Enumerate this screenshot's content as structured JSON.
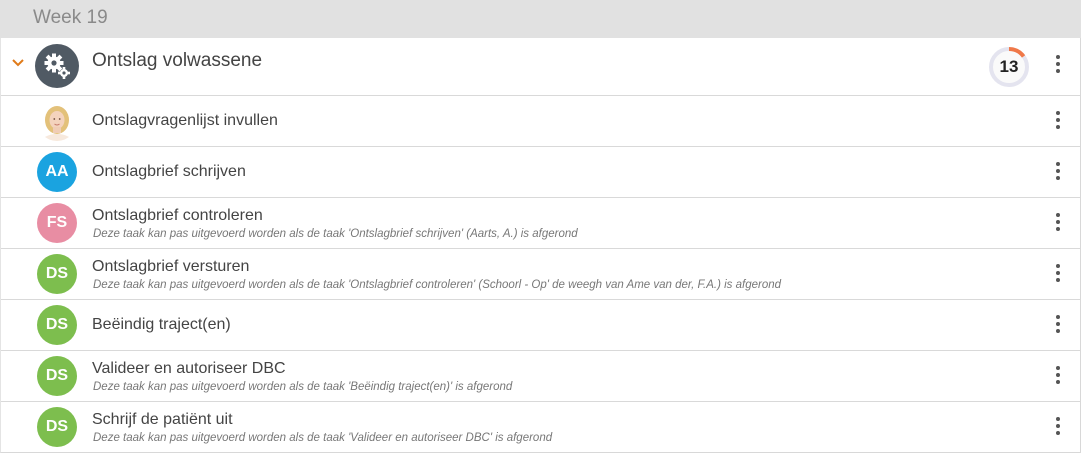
{
  "week": {
    "title": "Week 19"
  },
  "group": {
    "title": "Ontslag volwassene",
    "counter": "13",
    "progress": 0.15,
    "icon": "gears-icon",
    "expanded": true
  },
  "colors": {
    "blue": "#1aa3e0",
    "pink": "#e88da3",
    "green": "#7dbe4e",
    "accent": "#e07b1a",
    "progress": "#f07848"
  },
  "tasks": [
    {
      "title": "Ontslagvragenlijst invullen",
      "avatar": "photo",
      "note": ""
    },
    {
      "title": "Ontslagbrief schrijven",
      "avatar": "AA",
      "note": ""
    },
    {
      "title": "Ontslagbrief controleren",
      "avatar": "FS",
      "note": "Deze taak kan pas uitgevoerd worden als de taak 'Ontslagbrief schrijven' (Aarts, A.) is afgerond"
    },
    {
      "title": "Ontslagbrief versturen",
      "avatar": "DS",
      "note": "Deze taak kan pas uitgevoerd worden als de taak 'Ontslagbrief controleren' (Schoorl - Op' de weegh van Ame van der, F.A.) is afgerond"
    },
    {
      "title": "Beëindig traject(en)",
      "avatar": "DS",
      "note": ""
    },
    {
      "title": "Valideer en autoriseer DBC",
      "avatar": "DS",
      "note": "Deze taak kan pas uitgevoerd worden als de taak 'Beëindig traject(en)' is afgerond"
    },
    {
      "title": "Schrijf de patiënt uit",
      "avatar": "DS",
      "note": "Deze taak kan pas uitgevoerd worden als de taak 'Valideer en autoriseer DBC' is afgerond"
    }
  ]
}
